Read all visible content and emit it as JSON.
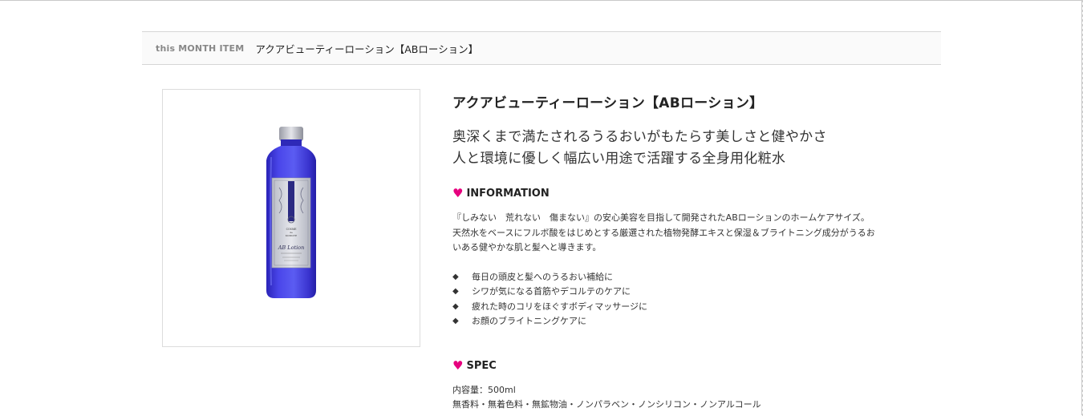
{
  "month_bar": {
    "label": "this MONTH ITEM",
    "title": "アクアビューティーローション【ABローション】"
  },
  "product": {
    "name": "アクアビューティーローション【ABローション】",
    "catch_line_1": "奥深くまで満たされるうるおいがもたらす美しさと健やかさ",
    "catch_line_2": "人と環境に優しく幅広い用途で活躍する全身用化粧水",
    "image": {
      "bottle_label_line_1": "COSME",
      "bottle_label_line_2": "de",
      "bottle_label_line_3": "KOMOTE",
      "bottle_label_script": "AB Lotion",
      "bottle_color": "#3f3ad6",
      "cap_color": "#c9cbd2"
    }
  },
  "information": {
    "heading": "INFORMATION",
    "heart_icon": "heart-icon",
    "heart_color": "#e6007e",
    "paragraph_line_1": "『しみない　荒れない　傷まない』の安心美容を目指して開発されたABローションのホームケアサイズ。",
    "paragraph_line_2": "天然水をベースにフルボ酸をはじめとする厳選された植物発酵エキスと保湿＆ブライトニング成分がうるお",
    "paragraph_line_3": "いある健やかな肌と髪へと導きます。",
    "bullet_mark": "◆",
    "bullets": [
      "毎日の頭皮と髪へのうるおい補給に",
      "シワが気になる首筋やデコルテのケアに",
      "疲れた時のコリをほぐすボディマッサージに",
      "お顔のブライトニングケアに"
    ]
  },
  "spec": {
    "heading": "SPEC",
    "volume": "内容量：500ml",
    "free_from": "無香料・無着色料・無鉱物油・ノンパラベン・ノンシリコン・ノンアルコール"
  }
}
